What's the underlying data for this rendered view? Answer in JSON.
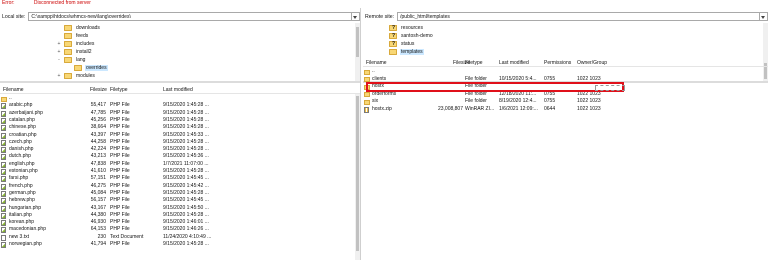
{
  "top_status": [
    "Error:",
    "Disconnected from server"
  ],
  "local": {
    "label": "Local site:",
    "path": "C:\\xampp\\htdocs\\whmcs-new\\lang\\overrides\\",
    "tree": [
      {
        "name": "downloads",
        "twisty": ""
      },
      {
        "name": "feeds",
        "twisty": ""
      },
      {
        "name": "includes",
        "twisty": "+"
      },
      {
        "name": "install2",
        "twisty": "+"
      },
      {
        "name": "lang",
        "twisty": "-"
      },
      {
        "name": "overrides",
        "twisty": "",
        "selected": true
      },
      {
        "name": "modules",
        "twisty": "+"
      }
    ],
    "columns": [
      "Filename",
      "Filesize",
      "Filetype",
      "Last modified"
    ],
    "files": [
      {
        "name": "..",
        "size": "",
        "type": "",
        "modified": "",
        "icon": "folder"
      },
      {
        "name": "arabic.php",
        "size": "55,417",
        "type": "PHP File",
        "modified": "9/15/2020 1:45:28 ...",
        "icon": "php"
      },
      {
        "name": "azerbaijani.php",
        "size": "47,785",
        "type": "PHP File",
        "modified": "9/15/2020 1:45:28 ...",
        "icon": "php"
      },
      {
        "name": "catalan.php",
        "size": "45,256",
        "type": "PHP File",
        "modified": "9/15/2020 1:45:28 ...",
        "icon": "php"
      },
      {
        "name": "chinese.php",
        "size": "38,664",
        "type": "PHP File",
        "modified": "9/15/2020 1:45:28 ...",
        "icon": "php"
      },
      {
        "name": "croatian.php",
        "size": "43,397",
        "type": "PHP File",
        "modified": "9/15/2020 1:45:33 ...",
        "icon": "php"
      },
      {
        "name": "czech.php",
        "size": "44,258",
        "type": "PHP File",
        "modified": "9/15/2020 1:45:28 ...",
        "icon": "php"
      },
      {
        "name": "danish.php",
        "size": "42,224",
        "type": "PHP File",
        "modified": "9/15/2020 1:45:28 ...",
        "icon": "php"
      },
      {
        "name": "dutch.php",
        "size": "43,213",
        "type": "PHP File",
        "modified": "9/15/2020 1:45:36 ...",
        "icon": "php"
      },
      {
        "name": "english.php",
        "size": "47,838",
        "type": "PHP File",
        "modified": "1/7/2021 11:07:00 ...",
        "icon": "php"
      },
      {
        "name": "estonian.php",
        "size": "41,610",
        "type": "PHP File",
        "modified": "9/15/2020 1:45:28 ...",
        "icon": "php"
      },
      {
        "name": "farsi.php",
        "size": "57,151",
        "type": "PHP File",
        "modified": "9/15/2020 1:45:45 ...",
        "icon": "php"
      },
      {
        "name": "french.php",
        "size": "46,275",
        "type": "PHP File",
        "modified": "9/15/2020 1:45:42 ...",
        "icon": "php"
      },
      {
        "name": "german.php",
        "size": "45,084",
        "type": "PHP File",
        "modified": "9/15/2020 1:45:28 ...",
        "icon": "php"
      },
      {
        "name": "hebrew.php",
        "size": "56,157",
        "type": "PHP File",
        "modified": "9/15/2020 1:45:45 ...",
        "icon": "php"
      },
      {
        "name": "hungarian.php",
        "size": "43,167",
        "type": "PHP File",
        "modified": "9/15/2020 1:45:50 ...",
        "icon": "php"
      },
      {
        "name": "italian.php",
        "size": "44,380",
        "type": "PHP File",
        "modified": "9/15/2020 1:45:28 ...",
        "icon": "php"
      },
      {
        "name": "korean.php",
        "size": "46,930",
        "type": "PHP File",
        "modified": "9/15/2020 1:46:01 ...",
        "icon": "php"
      },
      {
        "name": "macedonian.php",
        "size": "64,153",
        "type": "PHP File",
        "modified": "9/15/2020 1:46:26 ...",
        "icon": "php"
      },
      {
        "name": "new 3.txt",
        "size": "230",
        "type": "Text Document",
        "modified": "11/24/2020 4:10:49 ...",
        "icon": "txt"
      },
      {
        "name": "norwegian.php",
        "size": "41,794",
        "type": "PHP File",
        "modified": "9/15/2020 1:45:28 ...",
        "icon": "php"
      }
    ]
  },
  "remote": {
    "label": "Remote site:",
    "path": "/public_html/templates",
    "tree": [
      {
        "name": "resources",
        "icon": "question"
      },
      {
        "name": "santosh-demo",
        "icon": "question"
      },
      {
        "name": "status",
        "icon": "question"
      },
      {
        "name": "templates",
        "icon": "folder",
        "selected": true
      }
    ],
    "columns": [
      "Filename",
      "Filesize",
      "Filetype",
      "Last modified",
      "Permissions",
      "Owner/Group"
    ],
    "files": [
      {
        "name": "..",
        "size": "",
        "type": "",
        "modified": "",
        "perms": "",
        "owner": "",
        "icon": "folder"
      },
      {
        "name": "clients",
        "size": "",
        "type": "File folder",
        "modified": "10/15/2020 5:4...",
        "perms": "0755",
        "owner": "1022 1023",
        "icon": "folder"
      },
      {
        "name": "hostx",
        "size": "",
        "type": "File folder",
        "modified": "",
        "perms": "",
        "owner": "",
        "icon": "folder"
      },
      {
        "name": "orderforms",
        "size": "",
        "type": "File folder",
        "modified": "12/18/2020 11:...",
        "perms": "0755",
        "owner": "1022 1023",
        "icon": "folder"
      },
      {
        "name": "six",
        "size": "",
        "type": "File folder",
        "modified": "8/19/2020 12:4...",
        "perms": "0755",
        "owner": "1022 1023",
        "icon": "folder"
      },
      {
        "name": "hostx.zip",
        "size": "23,008,807",
        "type": "WinRAR ZI...",
        "modified": "1/6/2021 12:09:...",
        "perms": "0644",
        "owner": "1022 1023",
        "icon": "zip"
      }
    ]
  }
}
